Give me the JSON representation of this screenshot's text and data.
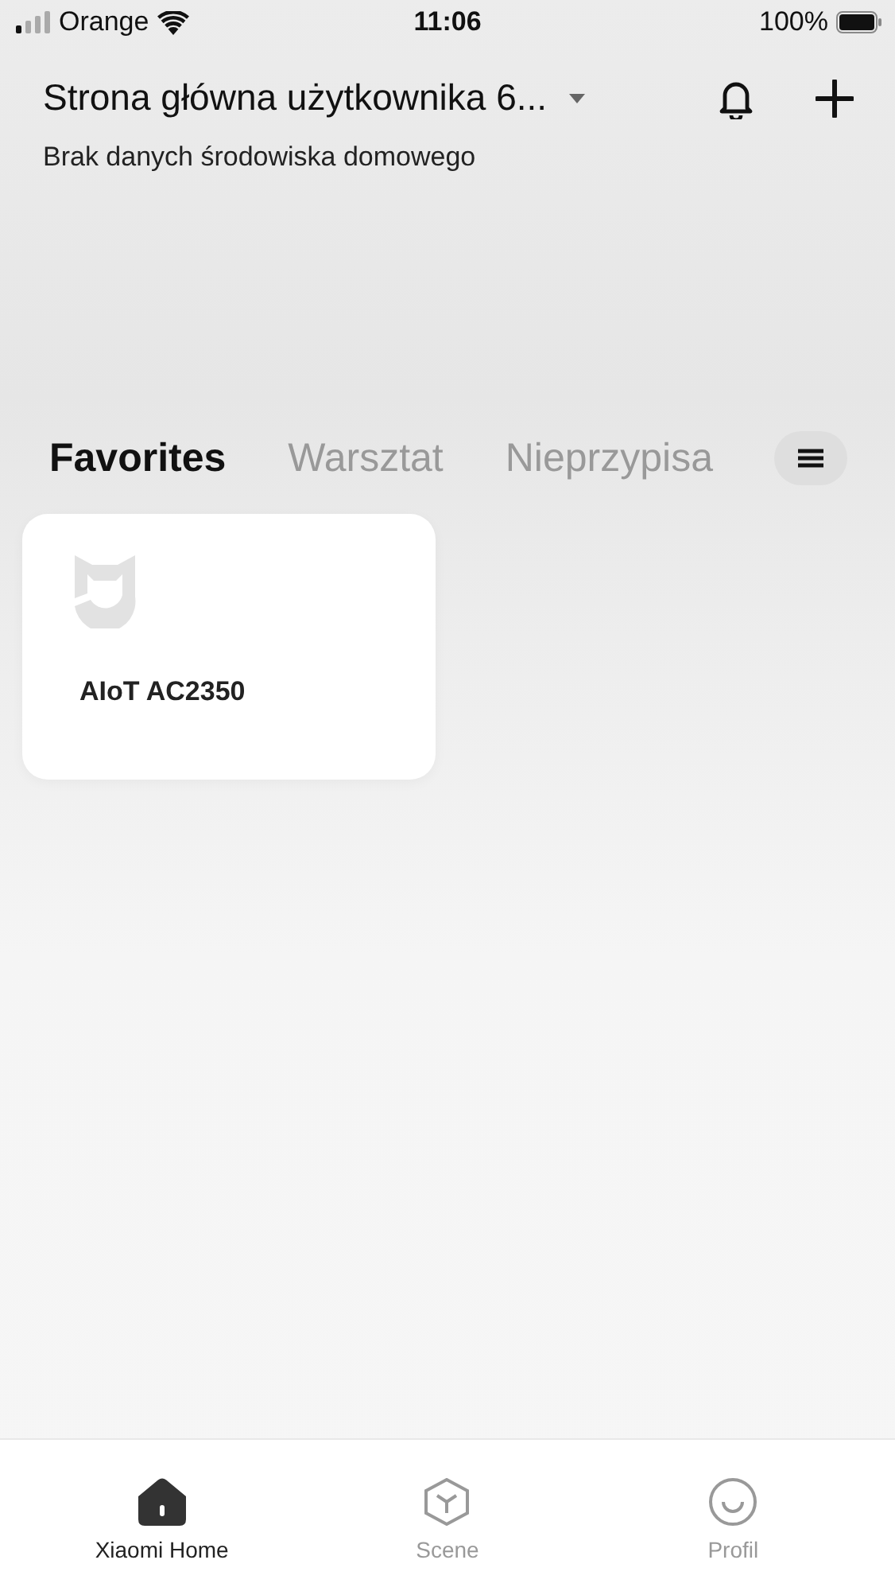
{
  "status_bar": {
    "carrier": "Orange",
    "time": "11:06",
    "battery": "100%"
  },
  "header": {
    "title": "Strona główna użytkownika 6...",
    "subtitle": "Brak danych środowiska domowego"
  },
  "tabs": [
    {
      "label": "Favorites",
      "selected": true
    },
    {
      "label": "Warsztat",
      "selected": false
    },
    {
      "label": "Nieprzypisa",
      "selected": false
    }
  ],
  "devices": [
    {
      "name": "AIoT AC2350"
    }
  ],
  "bottom_nav": [
    {
      "label": "Xiaomi Home",
      "kind": "home",
      "selected": true
    },
    {
      "label": "Scene",
      "kind": "scene",
      "selected": false
    },
    {
      "label": "Profil",
      "kind": "profile",
      "selected": false
    }
  ]
}
